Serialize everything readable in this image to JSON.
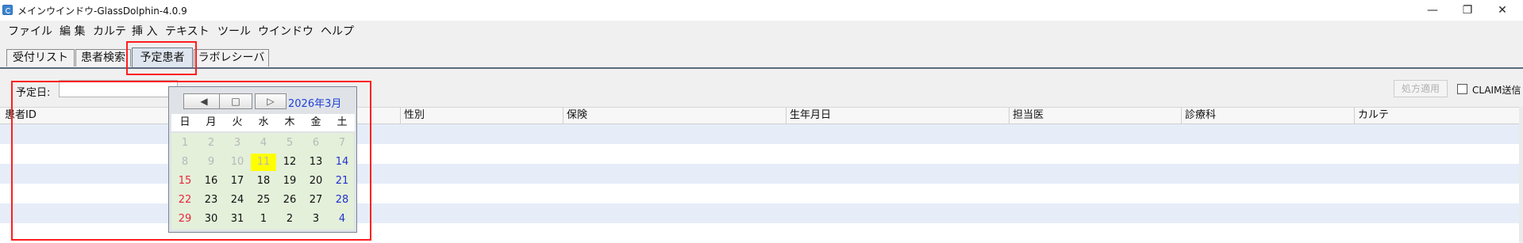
{
  "window": {
    "title": "メインウインドウ-GlassDolphin-4.0.9",
    "minimize": "—",
    "maximize": "❐",
    "close": "✕"
  },
  "menu": [
    "ファイル",
    "編 集",
    "カルテ",
    "挿 入",
    "テキスト",
    "ツール",
    "ウインドウ",
    "ヘルプ"
  ],
  "tabs": [
    "受付リスト",
    "患者検索",
    "予定患者",
    "ラボレシーバ"
  ],
  "active_tab": "予定患者",
  "toolbar": {
    "date_label": "予定日:",
    "date_value": "",
    "prescription_button": "処方適用",
    "claim_label": "CLAIM送信",
    "claim_checked": false
  },
  "table": {
    "columns": [
      "患者ID",
      "",
      "性別",
      "保険",
      "生年月日",
      "担当医",
      "診療科",
      "カルテ"
    ],
    "rows": []
  },
  "calendar": {
    "prev": "◀",
    "today": "□",
    "next": "▷",
    "month_label": "2026年3月",
    "weekdays": [
      "日",
      "月",
      "火",
      "水",
      "木",
      "金",
      "土"
    ],
    "weeks": [
      [
        "1",
        "2",
        "3",
        "4",
        "5",
        "6",
        "7"
      ],
      [
        "8",
        "9",
        "10",
        "11",
        "12",
        "13",
        "14"
      ],
      [
        "15",
        "16",
        "17",
        "18",
        "19",
        "20",
        "21"
      ],
      [
        "22",
        "23",
        "24",
        "25",
        "26",
        "27",
        "28"
      ],
      [
        "29",
        "30",
        "31",
        "1",
        "2",
        "3",
        "4"
      ]
    ],
    "selected": "11",
    "colors": {
      "sunday": "#e8263a",
      "saturday": "#2233cc",
      "disabled": "#b8b8b8",
      "selected_bg": "#ffff00",
      "month": "#1f3fd6"
    }
  },
  "highlight_color": "#ff1e1e"
}
